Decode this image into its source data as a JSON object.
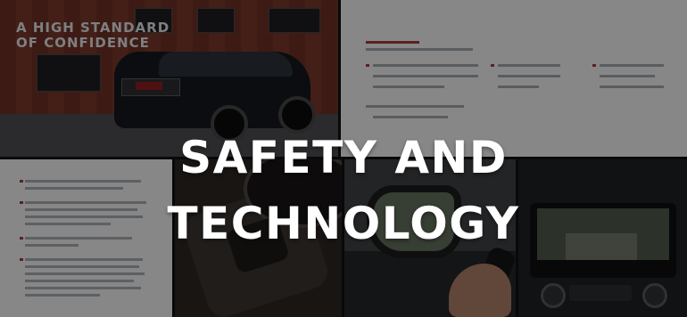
{
  "banner": {
    "headline": "SAFETY AND TECHNOLOGY",
    "tagline_line1": "A HIGH STANDARD",
    "tagline_line2": "OF CONFIDENCE"
  },
  "colors": {
    "headline_text": "#ffffff",
    "overlay": "#000000",
    "brand_red": "#8a1c20"
  }
}
